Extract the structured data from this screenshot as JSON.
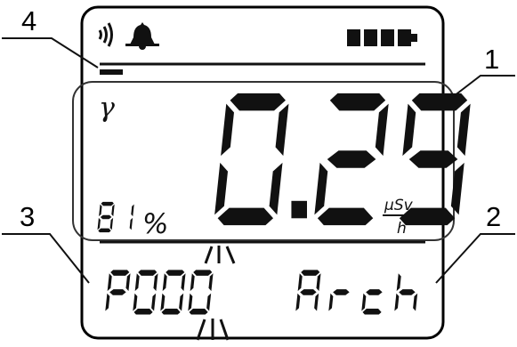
{
  "callouts": [
    "4",
    "1",
    "3",
    "2"
  ],
  "reading": "0.29",
  "unit": {
    "numerator": "μSv",
    "denominator": "h"
  },
  "radiation_symbol": "γ",
  "percent": "81%",
  "program": "P000",
  "mode": "Arch",
  "battery_level": 1.0,
  "indicators": [
    "sound-icon",
    "bell-icon",
    "battery-icon"
  ],
  "colors": {
    "ink": "#111111",
    "frame": "#000000",
    "background": "#ffffff"
  }
}
